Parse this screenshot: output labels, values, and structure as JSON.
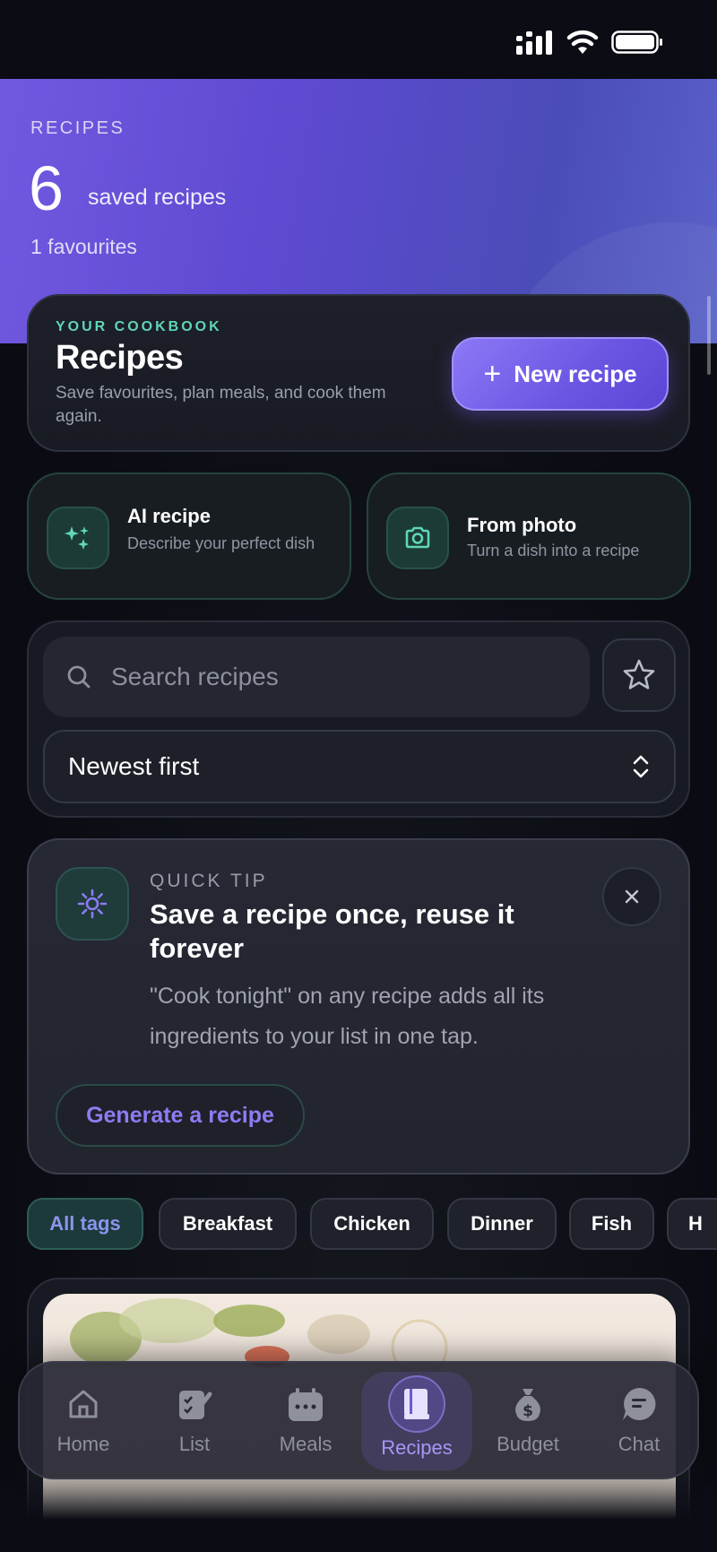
{
  "status_bar": {
    "signal_icon": "signal-icon",
    "wifi_icon": "wifi-icon",
    "battery_icon": "battery-icon"
  },
  "hero": {
    "kicker": "RECIPES",
    "count": "6",
    "count_label": "saved recipes",
    "favourites": "1 favourites",
    "accent": "#6b55e0"
  },
  "cookbook": {
    "kicker": "YOUR COOKBOOK",
    "title": "Recipes",
    "subtitle": "Save favourites, plan meals, and cook them again.",
    "new_button": "New recipe",
    "accent": "#5fd6b6"
  },
  "actions": [
    {
      "title": "AI recipe",
      "subtitle": "Describe your perfect dish",
      "icon": "sparkles-icon"
    },
    {
      "title": "From photo",
      "subtitle": "Turn a dish into a recipe",
      "icon": "camera-icon"
    }
  ],
  "search": {
    "placeholder": "Search recipes",
    "value": "",
    "favourites_filter_icon": "star-icon"
  },
  "sort": {
    "selected": "Newest first"
  },
  "tip": {
    "kicker": "QUICK TIP",
    "title": "Save a recipe once, reuse it forever",
    "body": "\"Cook tonight\" on any recipe adds all its ingredients to your list in one tap.",
    "cta": "Generate a recipe",
    "icon": "sun-icon",
    "close_icon": "close-icon"
  },
  "tags": [
    "All tags",
    "Breakfast",
    "Chicken",
    "Dinner",
    "Fish",
    "H"
  ],
  "nav": {
    "items": [
      {
        "label": "Home",
        "icon": "home-icon"
      },
      {
        "label": "List",
        "icon": "checklist-icon"
      },
      {
        "label": "Meals",
        "icon": "calendar-icon"
      },
      {
        "label": "Recipes",
        "icon": "book-icon",
        "active": true
      },
      {
        "label": "Budget",
        "icon": "money-bag-icon"
      },
      {
        "label": "Chat",
        "icon": "chat-icon"
      }
    ]
  }
}
